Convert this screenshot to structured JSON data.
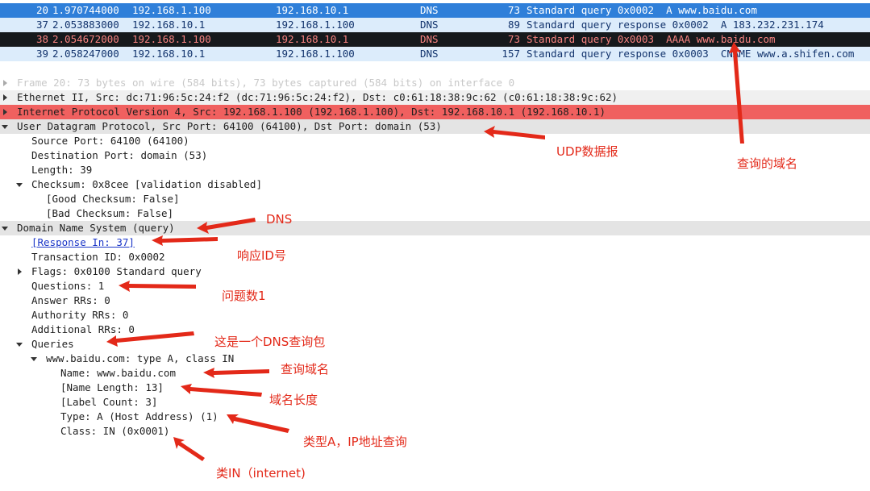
{
  "packets": [
    {
      "no": "20",
      "time": "1.970744000",
      "src": "192.168.1.100",
      "dst": "192.168.10.1",
      "proto": "DNS",
      "len": "73",
      "info": "Standard query 0x0002  A www.baidu.com"
    },
    {
      "no": "37",
      "time": "2.053883000",
      "src": "192.168.10.1",
      "dst": "192.168.1.100",
      "proto": "DNS",
      "len": "89",
      "info": "Standard query response 0x0002  A 183.232.231.174"
    },
    {
      "no": "38",
      "time": "2.054672000",
      "src": "192.168.1.100",
      "dst": "192.168.10.1",
      "proto": "DNS",
      "len": "73",
      "info": "Standard query 0x0003  AAAA www.baidu.com"
    },
    {
      "no": "39",
      "time": "2.058247000",
      "src": "192.168.10.1",
      "dst": "192.168.1.100",
      "proto": "DNS",
      "len": "157",
      "info": "Standard query response 0x0003  CNAME www.a.shifen.com"
    }
  ],
  "tree": {
    "frame": "Frame 20: 73 bytes on wire (584 bits), 73 bytes captured (584 bits) on interface 0",
    "ethernet": "Ethernet II, Src: dc:71:96:5c:24:f2 (dc:71:96:5c:24:f2), Dst: c0:61:18:38:9c:62 (c0:61:18:38:9c:62)",
    "ip": "Internet Protocol Version 4, Src: 192.168.1.100 (192.168.1.100), Dst: 192.168.10.1 (192.168.10.1)",
    "udp": "User Datagram Protocol, Src Port: 64100 (64100), Dst Port: domain (53)",
    "src_port": "Source Port: 64100 (64100)",
    "dst_port": "Destination Port: domain (53)",
    "length": "Length: 39",
    "checksum": "Checksum: 0x8cee [validation disabled]",
    "good_checksum": "[Good Checksum: False]",
    "bad_checksum": "[Bad Checksum: False]",
    "dns": "Domain Name System (query)",
    "response_in": "[Response In: 37]",
    "transaction_id": "Transaction ID: 0x0002",
    "flags": "Flags: 0x0100 Standard query",
    "questions": "Questions: 1",
    "answer_rrs": "Answer RRs: 0",
    "authority_rrs": "Authority RRs: 0",
    "additional_rrs": "Additional RRs: 0",
    "queries": "Queries",
    "query": "www.baidu.com: type A, class IN",
    "name": "Name: www.baidu.com",
    "name_length": "[Name Length: 13]",
    "label_count": "[Label Count: 3]",
    "type": "Type: A (Host Address) (1)",
    "class": "Class: IN (0x0001)"
  },
  "annotations": {
    "udp": "UDP数据报",
    "domain": "查询的域名",
    "dns": "DNS",
    "response_id": "响应ID号",
    "questions": "问题数1",
    "query_packet": "这是一个DNS查询包",
    "query_name": "查询域名",
    "name_length": "域名长度",
    "type_a": "类型A，IP地址查询",
    "class_in": "类IN（internet)"
  },
  "colors": {
    "selected": "#2f7fd9",
    "ip_highlight": "#f0605f",
    "annotation": "#e32919"
  }
}
